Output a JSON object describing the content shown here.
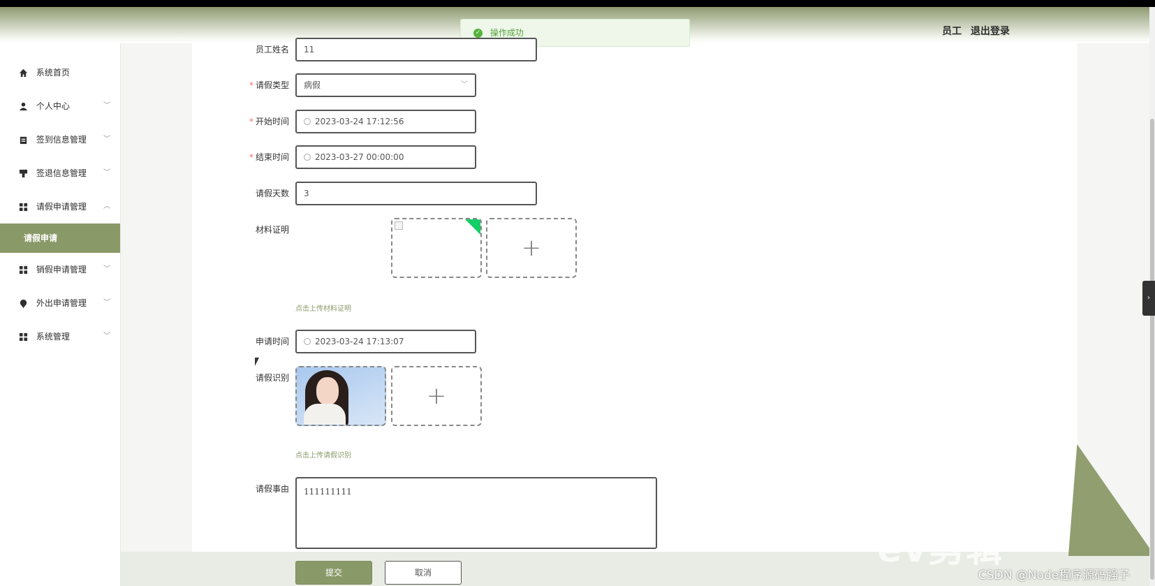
{
  "header": {
    "role": "员工",
    "logout": "退出登录"
  },
  "toast": {
    "message": "操作成功"
  },
  "sidebar": {
    "items": [
      {
        "label": "系统首页",
        "icon": "home-icon",
        "chev": ""
      },
      {
        "label": "个人中心",
        "icon": "user-icon",
        "chev": "﹀"
      },
      {
        "label": "签到信息管理",
        "icon": "clipboard-icon",
        "chev": "﹀"
      },
      {
        "label": "签退信息管理",
        "icon": "stamp-icon",
        "chev": "﹀"
      },
      {
        "label": "请假申请管理",
        "icon": "grid-icon",
        "chev": "︿"
      }
    ],
    "active_sub": "请假申请",
    "items_after": [
      {
        "label": "销假申请管理",
        "icon": "grid-icon",
        "chev": "﹀"
      },
      {
        "label": "外出申请管理",
        "icon": "location-icon",
        "chev": "﹀"
      },
      {
        "label": "系统管理",
        "icon": "grid-icon",
        "chev": "﹀"
      }
    ]
  },
  "form": {
    "employee_name": {
      "label": "员工姓名",
      "value": "11"
    },
    "leave_type": {
      "label": "请假类型",
      "value": "病假"
    },
    "start_time": {
      "label": "开始时间",
      "value": "2023-03-24 17:12:56"
    },
    "end_time": {
      "label": "结束时间",
      "value": "2023-03-27 00:00:00"
    },
    "leave_days": {
      "label": "请假天数",
      "value": "3"
    },
    "material": {
      "label": "材料证明",
      "hint": "点击上传材料证明"
    },
    "apply_time": {
      "label": "申请时间",
      "value": "2023-03-24 17:13:07"
    },
    "leave_id": {
      "label": "请假识别",
      "hint": "点击上传请假识别"
    },
    "reason": {
      "label": "请假事由",
      "value": "111111111"
    },
    "submit": "提交",
    "cancel": "取消"
  },
  "watermark": {
    "text": "ev剪辑",
    "credit": "CSDN @Node程序源码强子"
  },
  "colors": {
    "accent": "#8a9968",
    "success": "#55b33c",
    "required": "#f56c6c"
  }
}
